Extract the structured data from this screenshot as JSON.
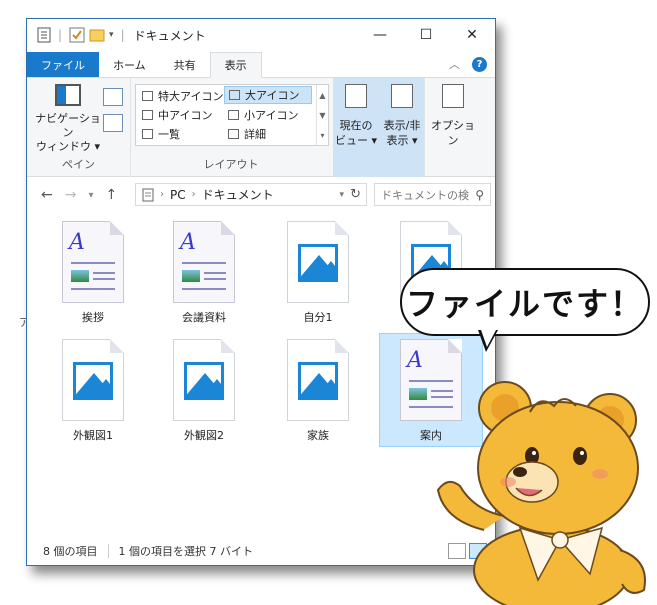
{
  "window": {
    "title": "ドキュメント",
    "controls": {
      "minimize": "—",
      "maximize": "☐",
      "close": "✕"
    }
  },
  "ribbon": {
    "tabs": [
      {
        "label": "ファイル"
      },
      {
        "label": "ホーム"
      },
      {
        "label": "共有"
      },
      {
        "label": "表示"
      }
    ],
    "pane_group": {
      "nav_pane": "ナビゲーション\nウィンドウ ▾",
      "label": "ペイン"
    },
    "layout_group": {
      "options": [
        "特大アイコン",
        "大アイコン",
        "中アイコン",
        "小アイコン",
        "一覧",
        "詳細"
      ],
      "selected": "大アイコン",
      "label": "レイアウト"
    },
    "current_view": "現在の\nビュー ▾",
    "show_hide": "表示/非\n表示 ▾",
    "options": "オプション"
  },
  "address": {
    "path": [
      "PC",
      "ドキュメント"
    ],
    "search_placeholder": "ドキュメントの検"
  },
  "files": [
    {
      "name": "挨拶",
      "type": "doc"
    },
    {
      "name": "会議資料",
      "type": "doc"
    },
    {
      "name": "自分1",
      "type": "image"
    },
    {
      "name": "外観図1",
      "type": "image"
    },
    {
      "name": "外観図2",
      "type": "image"
    },
    {
      "name": "家族",
      "type": "image"
    },
    {
      "name": "案内",
      "type": "doc",
      "selected": true
    }
  ],
  "status": {
    "count": "8 個の項目",
    "selection": "1 個の項目を選択  7 バイト"
  },
  "callout": {
    "text": "ファイルです！"
  },
  "edge_mark": "ア"
}
